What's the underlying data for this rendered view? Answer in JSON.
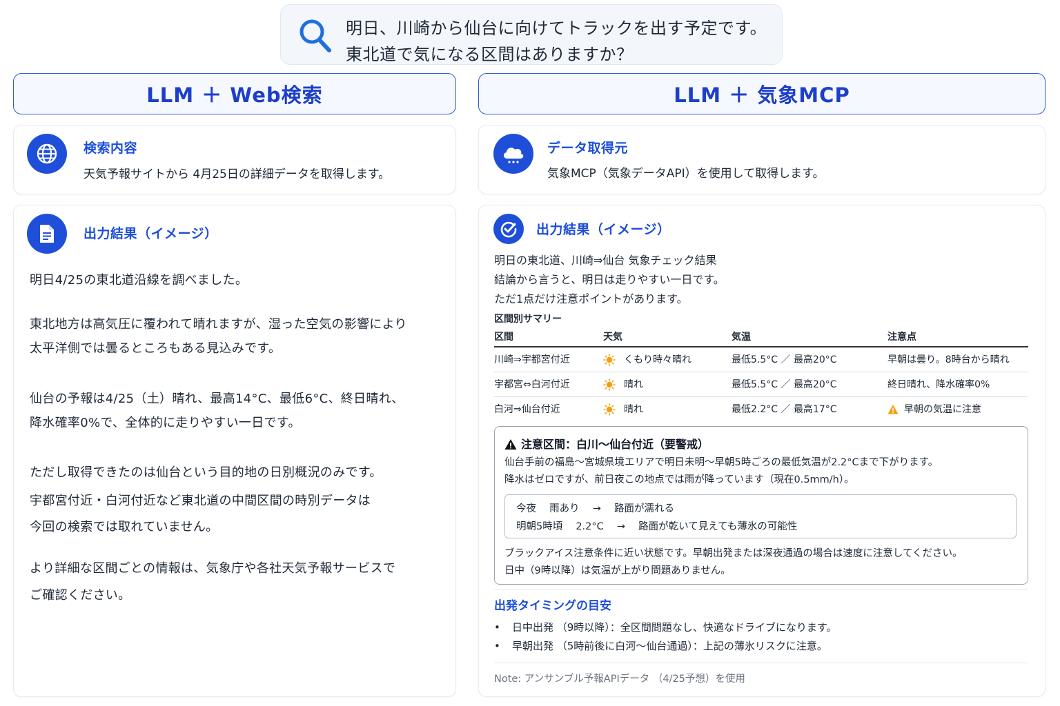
{
  "query": {
    "line1": "明日、川崎から仙台に向けてトラックを出す予定です。",
    "line2": "東北道で気になる区間はありますか？"
  },
  "left": {
    "header": "LLM ＋ Web検索",
    "search_card": {
      "title": "検索内容",
      "text": "天気予報サイトから 4月25日の詳細データを取得します。"
    },
    "output_card": {
      "title": "出力結果（イメージ）",
      "paragraphs": [
        "明日4/25の東北道沿線を調べました。",
        "東北地方は高気圧に覆われて晴れますが、湿った空気の影響により",
        "太平洋側では曇るところもある見込みです。",
        "仙台の予報は4/25（土）晴れ、最高14°C、最低6°C、終日晴れ、",
        "降水確率0%で、全体的に走りやすい一日です。",
        "ただし取得できたのは仙台という目的地の日別概況のみです。",
        "宇都宮付近・白河付近など東北道の中間区間の時別データは",
        "今回の検索では取れていません。",
        "より詳細な区間ごとの情報は、気象庁や各社天気予報サービスで",
        "ご確認ください。"
      ]
    }
  },
  "right": {
    "header": "LLM ＋ 気象MCP",
    "source_card": {
      "title": "データ取得元",
      "text": "気象MCP（気象データAPI）を使用して取得します。"
    },
    "output_card": {
      "title": "出力結果（イメージ）",
      "intro": [
        "明日の東北道、川崎⇒仙台 気象チェック結果",
        "結論から言うと、明日は走りやすい一日です。",
        "ただ1点だけ注意ポイントがあります。"
      ],
      "summary_title": "区間別サマリー",
      "columns": [
        "区間",
        "天気",
        "気温",
        "注意点"
      ],
      "rows": [
        {
          "section": "川崎⇒宇都宮付近",
          "weather": "くもり時々晴れ",
          "temp": "最低5.5°C ／ 最高20°C",
          "note": "早朝は曇り。8時台から晴れ",
          "warn": false
        },
        {
          "section": "宇都宮⇔白河付近",
          "weather": "晴れ",
          "temp": "最低5.5°C ／ 最高20°C",
          "note": "終日晴れ、降水確率0%",
          "warn": false
        },
        {
          "section": "白河⇒仙台付近",
          "weather": "晴れ",
          "temp": "最低2.2°C ／ 最高17°C",
          "note": "早朝の気温に注意",
          "warn": true
        }
      ],
      "caution": {
        "title": "注意区間：白川〜仙台付近（要警戒）",
        "line1": "仙台手前の福島〜宮城県境エリアで明日未明〜早朝5時ごろの最低気温が2.2°Cまで下がります。",
        "line2": "降水はゼロですが、前日夜この地点では雨が降っています（現在0.5mm/h）。",
        "inner1": "今夜　 雨あり　 →　 路面が濡れる",
        "inner2": "明朝5時頃　 2.2°C　 →　 路面が乾いて見えても薄氷の可能性",
        "line3": "ブラックアイス注意条件に近い状態です。早朝出発または深夜通過の場合は速度に注意してください。",
        "line4": "日中（9時以降）は気温が上がり問題ありません。"
      },
      "timing_title": "出発タイミングの目安",
      "bullets": [
        "日中出発 （9時以降）：全区間問題なし、快適なドライブになります。",
        "早朝出発 （5時前後に白河〜仙台通過）：上記の薄氷リスクに注意。"
      ],
      "bullet_marker": "•",
      "note": "Note: アンサンブル予報APIデータ （4/25予想）を使用"
    }
  },
  "colors": {
    "accent": "#1f4fd8",
    "title_blue": "#1d4ed8",
    "sun": "#f59e0b",
    "warn": "#f59e0b"
  },
  "icons": [
    "search-icon",
    "globe-icon",
    "cloud-icon",
    "document-icon",
    "check-icon",
    "sun-icon",
    "warning-icon"
  ]
}
